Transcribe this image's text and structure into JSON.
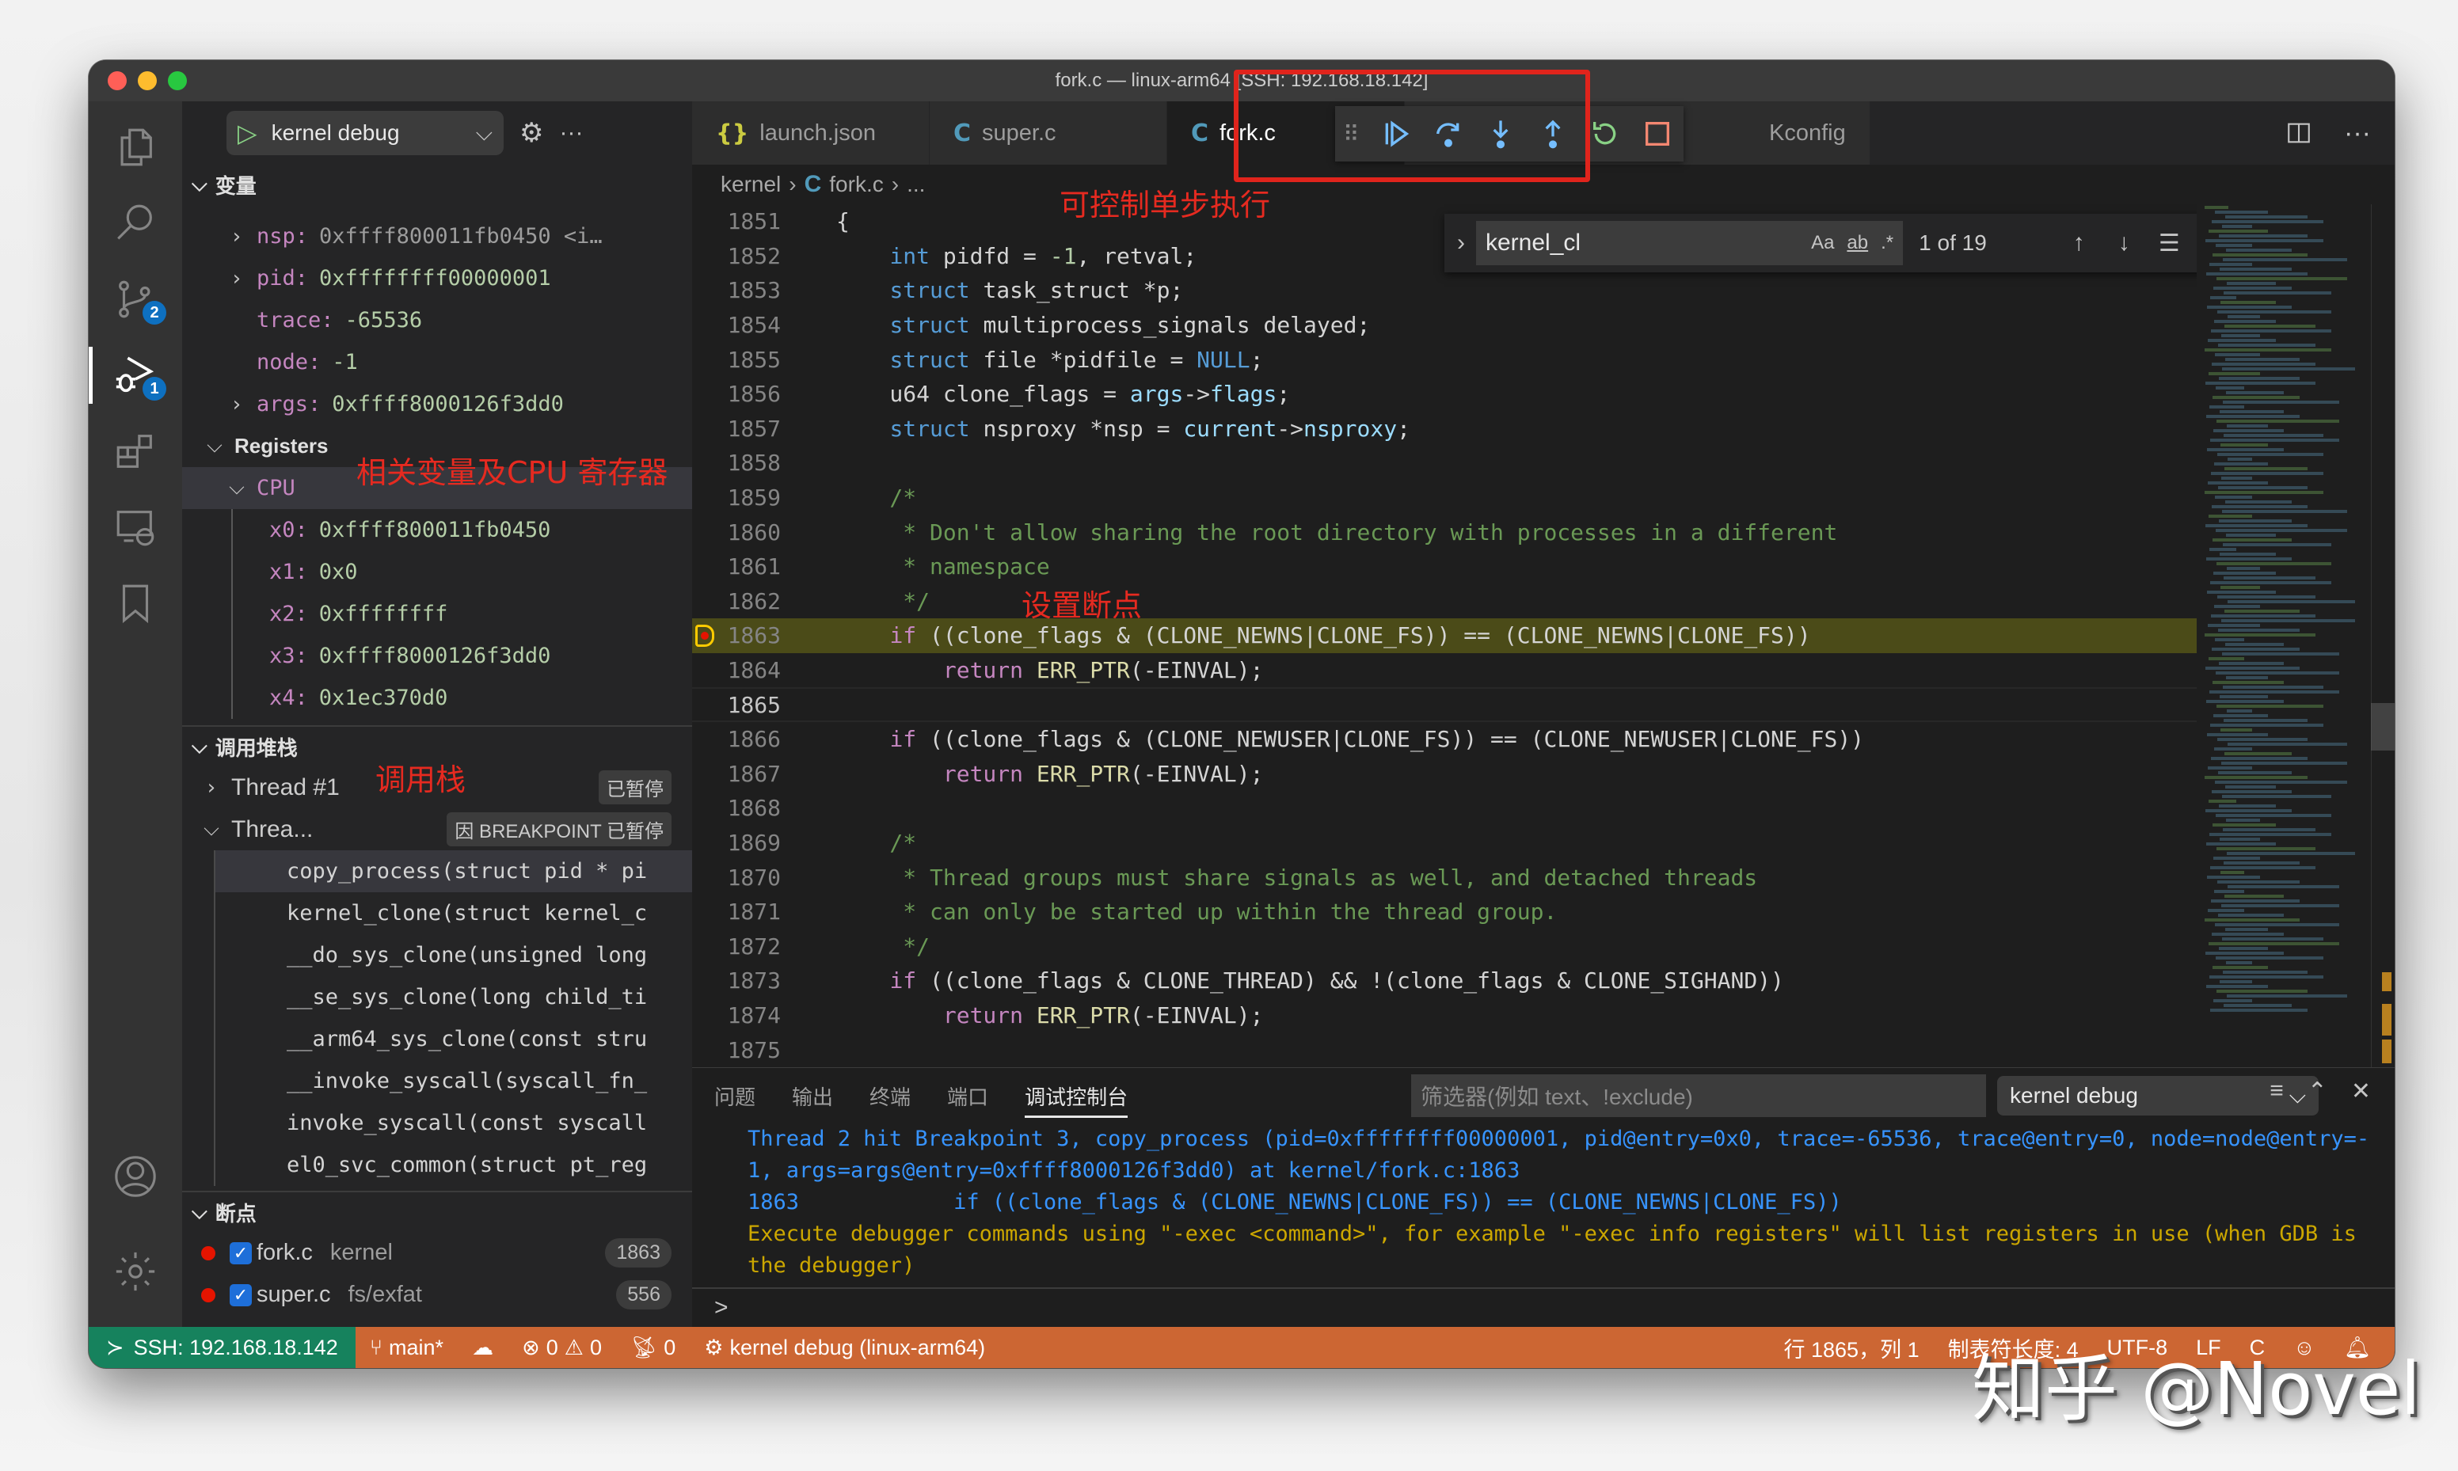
{
  "window": {
    "title": "fork.c — linux-arm64 [SSH: 192.168.18.142]"
  },
  "activity_bar": {
    "items": [
      {
        "name": "explorer",
        "icon": "files-icon"
      },
      {
        "name": "search",
        "icon": "search-icon"
      },
      {
        "name": "source-control",
        "icon": "git-branch-icon",
        "badge": "2"
      },
      {
        "name": "run-debug",
        "icon": "debug-icon",
        "badge": "1",
        "active": true
      },
      {
        "name": "extensions",
        "icon": "extensions-icon"
      },
      {
        "name": "remote-explorer",
        "icon": "remote-icon"
      },
      {
        "name": "bookmarks",
        "icon": "bookmark-icon"
      }
    ],
    "bottom": [
      {
        "name": "accounts",
        "icon": "account-icon"
      },
      {
        "name": "manage",
        "icon": "gear-icon"
      }
    ]
  },
  "sidebar": {
    "launch_config": "kernel debug",
    "variables": {
      "title": "变量",
      "items": [
        {
          "name": "nsp:",
          "value": "0xffff800011fb0450 <i…",
          "expandable": true,
          "grey": true
        },
        {
          "name": "pid:",
          "value": "0xffffffff00000001",
          "expandable": true
        },
        {
          "name": "trace:",
          "value": "-65536",
          "expandable": false
        },
        {
          "name": "node:",
          "value": "-1",
          "expandable": false
        },
        {
          "name": "args:",
          "value": "0xffff8000126f3dd0",
          "expandable": true
        }
      ],
      "registers_label": "Registers",
      "cpu_label": "CPU",
      "registers": [
        {
          "name": "x0:",
          "value": "0xffff800011fb0450"
        },
        {
          "name": "x1:",
          "value": "0x0"
        },
        {
          "name": "x2:",
          "value": "0xffffffff"
        },
        {
          "name": "x3:",
          "value": "0xffff8000126f3dd0"
        },
        {
          "name": "x4:",
          "value": "0x1ec370d0"
        }
      ]
    },
    "call_stack": {
      "title": "调用堆栈",
      "threads": [
        {
          "label": "Thread #1",
          "status": "已暂停",
          "expanded": false
        },
        {
          "label": "Threa...",
          "status": "因 BREAKPOINT 已暂停",
          "expanded": true
        }
      ],
      "frames": [
        "copy_process(struct pid * pi",
        "kernel_clone(struct kernel_c",
        "__do_sys_clone(unsigned long",
        "__se_sys_clone(long child_ti",
        "__arm64_sys_clone(const stru",
        "__invoke_syscall(syscall_fn_",
        "invoke_syscall(const syscall",
        "el0_svc_common(struct pt_reg"
      ]
    },
    "breakpoints": {
      "title": "断点",
      "items": [
        {
          "file": "fork.c",
          "path": "kernel",
          "line": "1863",
          "checked": true
        },
        {
          "file": "super.c",
          "path": "fs/exfat",
          "line": "556",
          "checked": true
        }
      ]
    }
  },
  "annotations": {
    "step_control": "可控制单步执行",
    "registers": "相关变量及CPU 寄存器",
    "breakpoint": "设置断点",
    "call_stack": "调用栈"
  },
  "editor": {
    "tabs": [
      {
        "label": "launch.json",
        "icon": "{}",
        "type": "json"
      },
      {
        "label": "super.c",
        "icon": "C",
        "type": "c"
      },
      {
        "label": "fork.c",
        "icon": "C",
        "type": "c",
        "active": true
      },
      {
        "label": "Kconfig",
        "icon": "",
        "type": "text"
      }
    ],
    "debug_toolbar": [
      "continue",
      "step-over",
      "step-into",
      "step-out",
      "restart",
      "stop"
    ],
    "breadcrumb": [
      "kernel",
      "fork.c",
      "..."
    ],
    "find": {
      "query": "kernel_cl",
      "match_case": "Aa",
      "whole_word": "ab",
      "regex": ".*",
      "count": "1 of 19"
    },
    "current_line": 1865,
    "breakpoint_line": 1863,
    "lines": [
      {
        "n": 1851,
        "tokens": [
          [
            "p",
            "{"
          ]
        ]
      },
      {
        "n": 1852,
        "tokens": [
          [
            "p",
            "    "
          ],
          [
            "kw",
            "int"
          ],
          [
            "p",
            " pidfd = "
          ],
          [
            "num",
            "-1"
          ],
          [
            "p",
            ", retval;"
          ]
        ]
      },
      {
        "n": 1853,
        "tokens": [
          [
            "p",
            "    "
          ],
          [
            "kw",
            "struct"
          ],
          [
            "p",
            " task_struct *p;"
          ]
        ]
      },
      {
        "n": 1854,
        "tokens": [
          [
            "p",
            "    "
          ],
          [
            "kw",
            "struct"
          ],
          [
            "p",
            " multiprocess_signals delayed;"
          ]
        ]
      },
      {
        "n": 1855,
        "tokens": [
          [
            "p",
            "    "
          ],
          [
            "kw",
            "struct"
          ],
          [
            "p",
            " file *pidfile = "
          ],
          [
            "kw",
            "NULL"
          ],
          [
            "p",
            ";"
          ]
        ]
      },
      {
        "n": 1856,
        "tokens": [
          [
            "p",
            "    u64 clone_flags = "
          ],
          [
            "var",
            "args"
          ],
          [
            "p",
            "->"
          ],
          [
            "var",
            "flags"
          ],
          [
            "p",
            ";"
          ]
        ]
      },
      {
        "n": 1857,
        "tokens": [
          [
            "p",
            "    "
          ],
          [
            "kw",
            "struct"
          ],
          [
            "p",
            " nsproxy *nsp = "
          ],
          [
            "var",
            "current"
          ],
          [
            "p",
            "->"
          ],
          [
            "var",
            "nsproxy"
          ],
          [
            "p",
            ";"
          ]
        ]
      },
      {
        "n": 1858,
        "tokens": []
      },
      {
        "n": 1859,
        "tokens": [
          [
            "cm",
            "    /*"
          ]
        ]
      },
      {
        "n": 1860,
        "tokens": [
          [
            "cm",
            "     * Don't allow sharing the root directory with processes in a different"
          ]
        ]
      },
      {
        "n": 1861,
        "tokens": [
          [
            "cm",
            "     * namespace"
          ]
        ]
      },
      {
        "n": 1862,
        "tokens": [
          [
            "cm",
            "     */"
          ]
        ]
      },
      {
        "n": 1863,
        "tokens": [
          [
            "p",
            "    "
          ],
          [
            "ctl",
            "if"
          ],
          [
            "p",
            " ((clone_flags & (CLONE_NEWNS|CLONE_FS)) == (CLONE_NEWNS|CLONE_FS))"
          ]
        ]
      },
      {
        "n": 1864,
        "tokens": [
          [
            "p",
            "        "
          ],
          [
            "ctl",
            "return"
          ],
          [
            "p",
            " "
          ],
          [
            "fn",
            "ERR_PTR"
          ],
          [
            "p",
            "(-EINVAL);"
          ]
        ]
      },
      {
        "n": 1865,
        "tokens": []
      },
      {
        "n": 1866,
        "tokens": [
          [
            "p",
            "    "
          ],
          [
            "ctl",
            "if"
          ],
          [
            "p",
            " ((clone_flags & (CLONE_NEWUSER|CLONE_FS)) == (CLONE_NEWUSER|CLONE_FS))"
          ]
        ]
      },
      {
        "n": 1867,
        "tokens": [
          [
            "p",
            "        "
          ],
          [
            "ctl",
            "return"
          ],
          [
            "p",
            " "
          ],
          [
            "fn",
            "ERR_PTR"
          ],
          [
            "p",
            "(-EINVAL);"
          ]
        ]
      },
      {
        "n": 1868,
        "tokens": []
      },
      {
        "n": 1869,
        "tokens": [
          [
            "cm",
            "    /*"
          ]
        ]
      },
      {
        "n": 1870,
        "tokens": [
          [
            "cm",
            "     * Thread groups must share signals as well, and detached threads"
          ]
        ]
      },
      {
        "n": 1871,
        "tokens": [
          [
            "cm",
            "     * can only be started up within the thread group."
          ]
        ]
      },
      {
        "n": 1872,
        "tokens": [
          [
            "cm",
            "     */"
          ]
        ]
      },
      {
        "n": 1873,
        "tokens": [
          [
            "p",
            "    "
          ],
          [
            "ctl",
            "if"
          ],
          [
            "p",
            " ((clone_flags & CLONE_THREAD) && !(clone_flags & CLONE_SIGHAND))"
          ]
        ]
      },
      {
        "n": 1874,
        "tokens": [
          [
            "p",
            "        "
          ],
          [
            "ctl",
            "return"
          ],
          [
            "p",
            " "
          ],
          [
            "fn",
            "ERR_PTR"
          ],
          [
            "p",
            "(-EINVAL);"
          ]
        ]
      },
      {
        "n": 1875,
        "tokens": []
      }
    ]
  },
  "panel": {
    "tabs": [
      "问题",
      "输出",
      "终端",
      "端口",
      "调试控制台"
    ],
    "active_tab": "调试控制台",
    "filter_placeholder": "筛选器(例如 text、!exclude)",
    "session": "kernel debug",
    "console": [
      {
        "color": "blue",
        "text": "Thread 2 hit Breakpoint 3, copy_process (pid=0xffffffff00000001, pid@entry=0x0, trace=-65536, trace@entry=0, node=node@entry=-1, args=args@entry=0xffff8000126f3dd0) at kernel/fork.c:1863"
      },
      {
        "color": "blue",
        "text": "1863\t        if ((clone_flags & (CLONE_NEWNS|CLONE_FS)) == (CLONE_NEWNS|CLONE_FS))"
      },
      {
        "color": "yellow",
        "text": "Execute debugger commands using \"-exec <command>\", for example \"-exec info registers\" will list registers in use (when GDB is the debugger)"
      }
    ],
    "prompt": ">"
  },
  "status_bar": {
    "remote": "SSH: 192.168.18.142",
    "branch": "main*",
    "errors": "0",
    "warnings": "0",
    "ports": "0",
    "debug_session": "kernel debug (linux-arm64)",
    "cursor": "行 1865，列 1",
    "tab_size": "制表符长度: 4",
    "encoding": "UTF-8",
    "eol": "LF",
    "language": "C"
  },
  "watermark": "知乎 @Novel",
  "colors": {
    "status_bar": "#cc6633",
    "remote": "#16825d",
    "breakpoint": "#e51400",
    "annotation": "#e62a20",
    "highlight_line": "#4b4b18"
  }
}
